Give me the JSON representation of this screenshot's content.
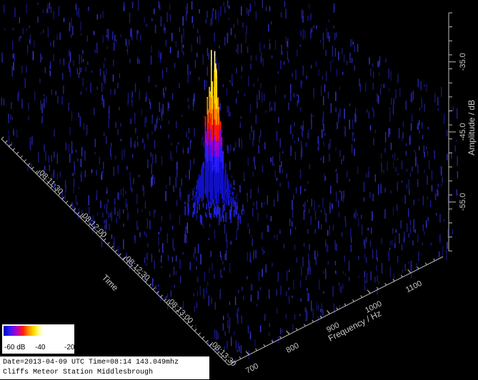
{
  "chart_data": {
    "type": "heatmap",
    "projection": "3d-waterfall",
    "time_axis": {
      "label": "Time",
      "ticks": [
        "08:11:30",
        "08:12:00",
        "08:12:30",
        "08:13:00",
        "08:13:30"
      ]
    },
    "frequency_axis": {
      "label": "Frequency / Hz",
      "ticks": [
        700,
        800,
        900,
        1000,
        1100
      ],
      "range": [
        650,
        1180
      ]
    },
    "amplitude_axis": {
      "label": "Amplitude / dB",
      "ticks": [
        -35.0,
        -45.0,
        -55.0
      ],
      "tick_labels": [
        "-35.0",
        "-45.0",
        "-55.0"
      ],
      "range": [
        -62,
        -28
      ]
    },
    "colorscale": {
      "labels": [
        "-60 dB",
        "-40",
        "-20"
      ],
      "colors": [
        "#0000b4",
        "#2a1cff",
        "#c000c0",
        "#ff2000",
        "#ff9000",
        "#ffe000",
        "#ffffff"
      ]
    },
    "meteor_echo": {
      "peak_frequency_hz": 840,
      "peak_time": "08:12:50",
      "peak_amplitude_db": -33
    },
    "background_noise_db": -60
  },
  "info": {
    "line1": "Date=2013-04-09 UTC Time=08:14 143.049mhz",
    "line2": "Cliffs Meteor Station Middlesbrough"
  }
}
